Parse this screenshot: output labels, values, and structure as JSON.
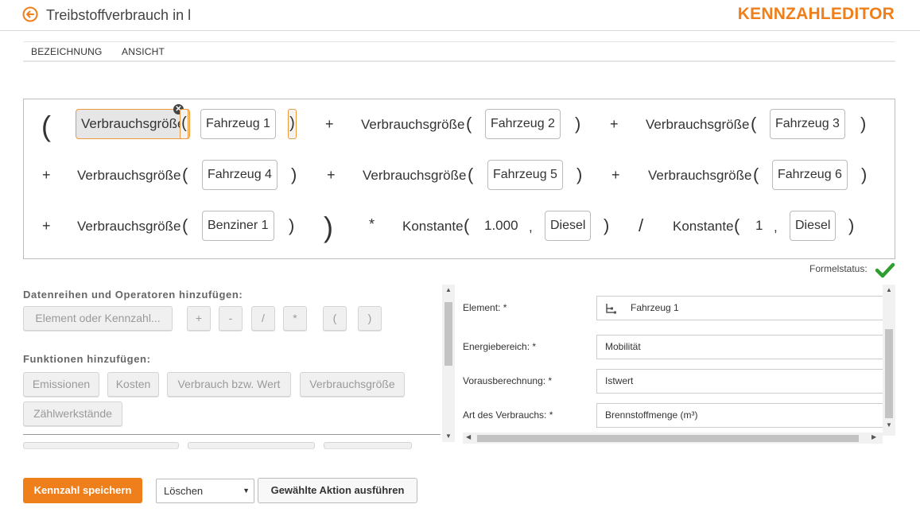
{
  "header": {
    "title": "Treibstoffverbrauch in l",
    "brand": "KENNZAHLEDITOR"
  },
  "tabs": [
    {
      "label": "BEZEICHNUNG"
    },
    {
      "label": "ANSICHT"
    }
  ],
  "formula": {
    "fn_usage": "Verbrauchsgröße",
    "fn_const": "Konstante",
    "vehicles": [
      "Fahrzeug 1",
      "Fahrzeug 2",
      "Fahrzeug 3",
      "Fahrzeug 4",
      "Fahrzeug 5",
      "Fahrzeug 6"
    ],
    "petrol": "Benziner 1",
    "const1_value": "1.000",
    "const1_unit": "Diesel",
    "const2_value": "1",
    "const2_unit": "Diesel",
    "op_plus": "+",
    "op_mult": "*",
    "op_div": "/",
    "comma": ",",
    "open_paren": "(",
    "close_paren": ")"
  },
  "formula_status": {
    "label": "Formelstatus:",
    "color": "#2e9e2e"
  },
  "left_panel": {
    "series_heading": "Datenreihen und Operatoren hinzufügen:",
    "element_button": "Element oder Kennzahl...",
    "operators": [
      "+",
      "-",
      "/",
      "*",
      "(",
      ")"
    ],
    "functions_heading": "Funktionen hinzufügen:",
    "functions": [
      "Emissionen",
      "Kosten",
      "Verbrauch bzw. Wert",
      "Verbrauchsgröße",
      "Zählwerkstände"
    ]
  },
  "right_panel": {
    "rows": [
      {
        "label": "Element: *",
        "value": "Fahrzeug 1"
      },
      {
        "label": "Energiebereich: *",
        "value": "Mobilität"
      },
      {
        "label": "Vorausberechnung: *",
        "value": "Istwert"
      },
      {
        "label": "Art des Verbrauchs: *",
        "value": "Brennstoffmenge (m³)"
      }
    ]
  },
  "bottom": {
    "save_label": "Kennzahl speichern",
    "action_select": "Löschen",
    "execute_label": "Gewählte Aktion ausführen"
  },
  "colors": {
    "accent": "#ee7f1b",
    "selected_border": "#ee9a3a"
  }
}
